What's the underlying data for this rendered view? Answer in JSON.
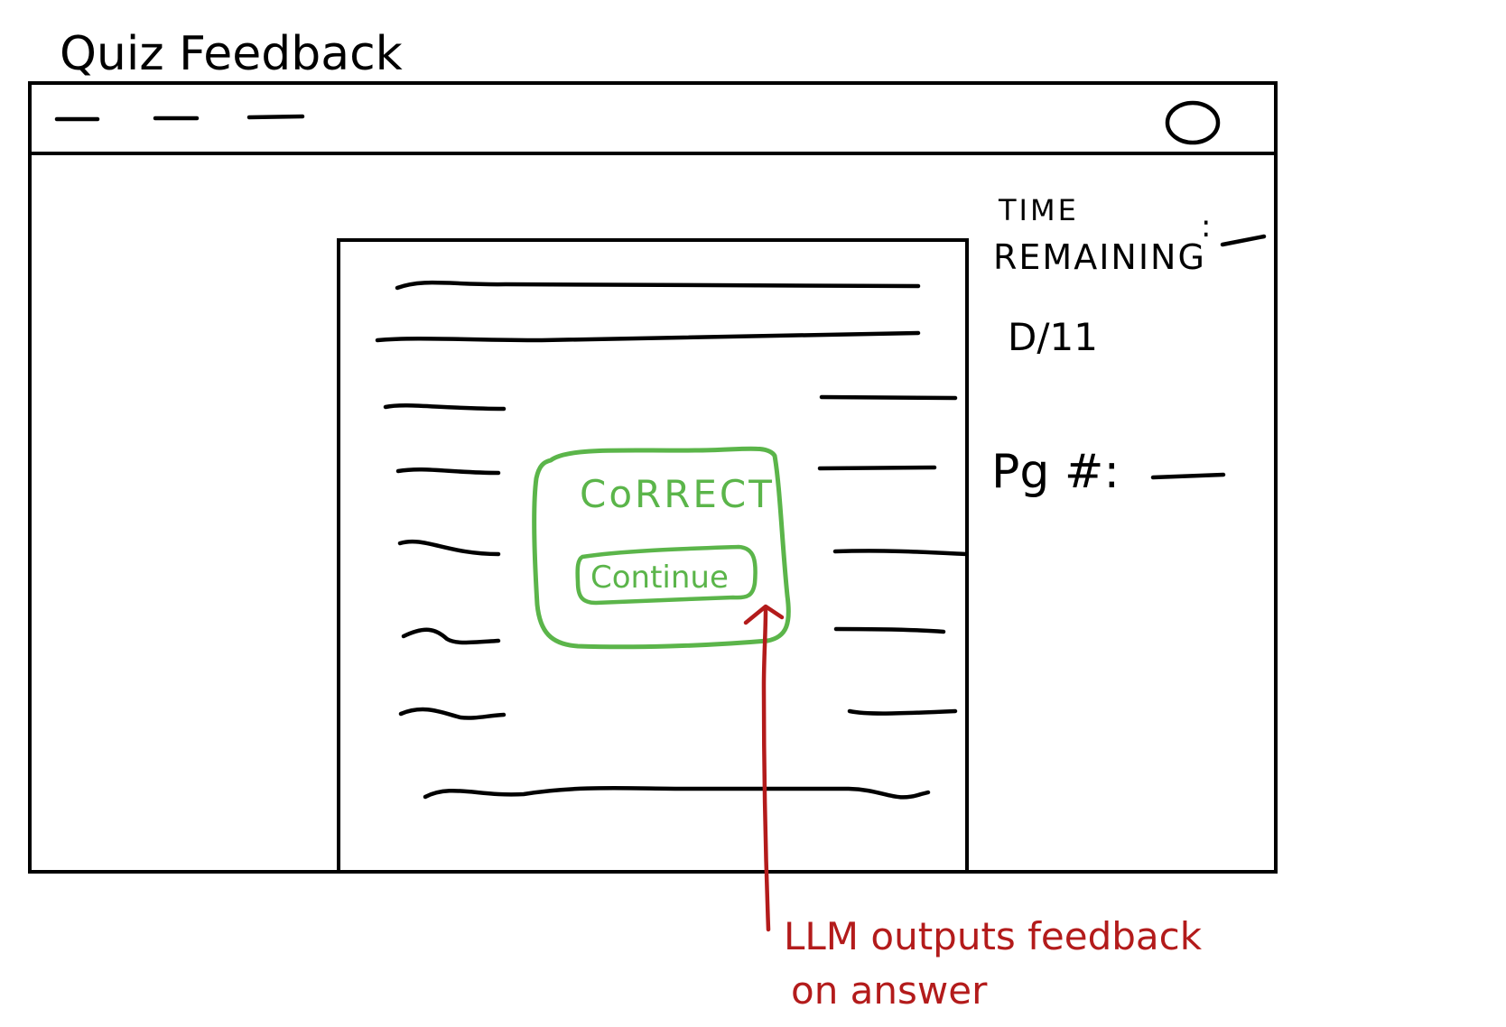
{
  "page_title": "Quiz Feedback",
  "sidebar": {
    "time_label_line1": "TIME",
    "time_label_line2": "REMAINING",
    "time_suffix": ":",
    "progress": "D/11",
    "page_label": "Pg #:"
  },
  "feedback": {
    "result": "CoRRECT",
    "continue_label": "Continue"
  },
  "annotation": {
    "line1": "LLM outputs feedback",
    "line2": "on answer"
  },
  "colors": {
    "ink": "#000000",
    "feedback_green": "#5bb54a",
    "annotation_red": "#b31b1b"
  }
}
